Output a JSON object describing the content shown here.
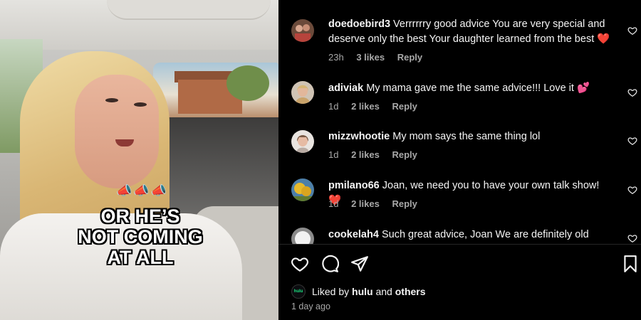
{
  "video": {
    "caption_lines": [
      "OR HE’S",
      "NOT COMING",
      "AT ALL"
    ],
    "emoji": "📣📣📣"
  },
  "comments": [
    {
      "username": "doedoebird3",
      "text": "Verrrrrry good advice You are very special and deserve only the best Your daughter learned from the best",
      "emoji": "❤️",
      "time": "23h",
      "likes": "3 likes",
      "reply": "Reply"
    },
    {
      "username": "adiviak",
      "text": "My mama gave me the same advice!!! Love it",
      "emoji": "💕",
      "time": "1d",
      "likes": "2 likes",
      "reply": "Reply"
    },
    {
      "username": "mizzwhootie",
      "text": "My mom says the same thing lol",
      "emoji": "",
      "time": "1d",
      "likes": "2 likes",
      "reply": "Reply"
    },
    {
      "username": "pmilano66",
      "text": "Joan, we need you to have your own talk show!",
      "emoji": "❤️",
      "time": "1d",
      "likes": "2 likes",
      "reply": "Reply"
    },
    {
      "username": "cookelah4",
      "text": "Such great advice, Joan We are definitely old",
      "emoji": "",
      "time": "",
      "likes": "",
      "reply": ""
    }
  ],
  "liked_by": {
    "prefix": "Liked by",
    "user": "hulu",
    "avatar_text": "hulu",
    "joiner": "and",
    "others": "others"
  },
  "timestamp": "1 day ago",
  "colors": {
    "background": "#000000",
    "text": "#f5f5f5",
    "secondary_text": "#a8a8a8",
    "heart": "#ff3040",
    "hulu_green": "#1ce783"
  },
  "icons": {
    "like": "heart-outline-icon",
    "comment": "speech-bubble-icon",
    "share": "paper-plane-icon",
    "save": "bookmark-icon"
  }
}
